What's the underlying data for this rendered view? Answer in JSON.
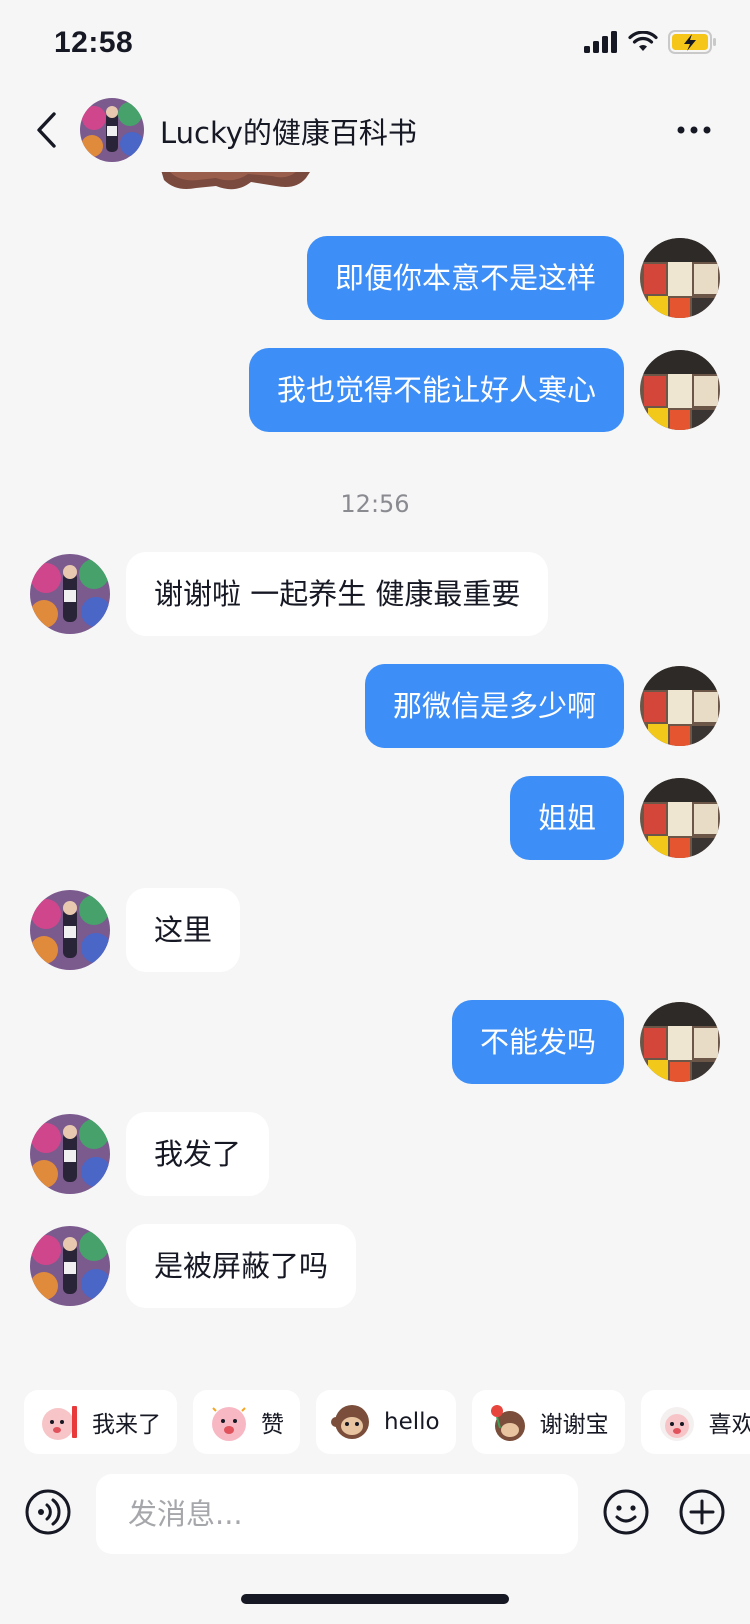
{
  "status_bar": {
    "time": "12:58",
    "battery_state": "charging"
  },
  "header": {
    "title": "Lucky的健康百科书"
  },
  "messages": [
    {
      "side": "out",
      "text": "即便你本意不是这样"
    },
    {
      "side": "out",
      "text": "我也觉得不能让好人寒心"
    },
    {
      "side": "in",
      "text": "谢谢啦 一起养生 健康最重要"
    },
    {
      "side": "out",
      "text": "那微信是多少啊"
    },
    {
      "side": "out",
      "text": "姐姐"
    },
    {
      "side": "in",
      "text": "这里"
    },
    {
      "side": "out",
      "text": "不能发吗"
    },
    {
      "side": "in",
      "text": "我发了"
    },
    {
      "side": "in",
      "text": "是被屏蔽了吗"
    }
  ],
  "timestamp": "12:56",
  "quick_replies": [
    {
      "label": "我来了",
      "icon": "sticker-icon"
    },
    {
      "label": "赞",
      "icon": "sticker-icon"
    },
    {
      "label": "hello",
      "icon": "sticker-icon"
    },
    {
      "label": "谢谢宝",
      "icon": "sticker-icon"
    },
    {
      "label": "喜欢",
      "icon": "sticker-icon"
    }
  ],
  "input": {
    "placeholder": "发消息..."
  },
  "colors": {
    "accent": "#3d8ef6",
    "background": "#f6f6f7",
    "bubble_in": "#ffffff"
  }
}
